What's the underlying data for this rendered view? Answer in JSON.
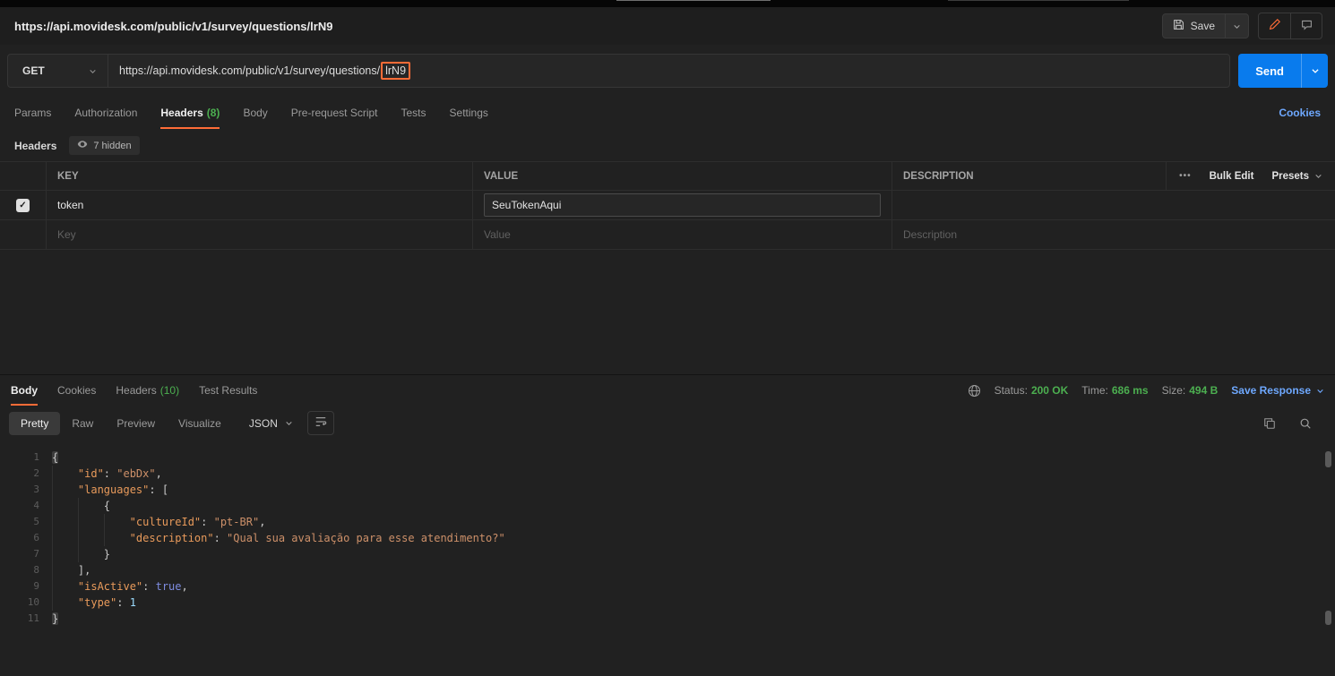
{
  "colors": {
    "accent": "#ff6c37",
    "green": "#4caf50",
    "link_blue": "#6ea8fe",
    "send_blue": "#097bed"
  },
  "titlebar": {
    "title": "https://api.movidesk.com/public/v1/survey/questions/lrN9",
    "save_label": "Save"
  },
  "request": {
    "method": "GET",
    "url_prefix": "https://api.movidesk.com/public/v1/survey/questions/",
    "url_highlight": "lrN9",
    "send_label": "Send"
  },
  "request_tabs": {
    "params": "Params",
    "authorization": "Authorization",
    "headers": "Headers",
    "headers_count": "(8)",
    "body": "Body",
    "prerequest": "Pre-request Script",
    "tests": "Tests",
    "settings": "Settings",
    "cookies_link": "Cookies"
  },
  "headers_section": {
    "title": "Headers",
    "hidden_badge": "7 hidden",
    "col_key": "KEY",
    "col_value": "VALUE",
    "col_description": "DESCRIPTION",
    "more_icon": "•••",
    "bulk_edit": "Bulk Edit",
    "presets": "Presets",
    "row": {
      "key": "token",
      "value": "SeuTokenAqui",
      "description": ""
    },
    "placeholder": {
      "key": "Key",
      "value": "Value",
      "description": "Description"
    },
    "checkbox_glyph": "✓"
  },
  "response": {
    "tab_body": "Body",
    "tab_cookies": "Cookies",
    "tab_headers": "Headers",
    "tab_headers_count": "(10)",
    "tab_test_results": "Test Results",
    "status_label": "Status:",
    "status_value": "200 OK",
    "time_label": "Time:",
    "time_value": "686 ms",
    "size_label": "Size:",
    "size_value": "494 B",
    "save_response": "Save Response",
    "view_pretty": "Pretty",
    "view_raw": "Raw",
    "view_preview": "Preview",
    "view_visualize": "Visualize",
    "format": "JSON"
  },
  "code": {
    "lines": [
      {
        "indent": 0,
        "tokens": [
          {
            "t": "{",
            "c": "p hl"
          }
        ]
      },
      {
        "indent": 1,
        "tokens": [
          {
            "t": "\"id\"",
            "c": "k"
          },
          {
            "t": ": ",
            "c": "p"
          },
          {
            "t": "\"ebDx\"",
            "c": "s"
          },
          {
            "t": ",",
            "c": "p"
          }
        ]
      },
      {
        "indent": 1,
        "tokens": [
          {
            "t": "\"languages\"",
            "c": "k"
          },
          {
            "t": ": ",
            "c": "p"
          },
          {
            "t": "[",
            "c": "p"
          }
        ]
      },
      {
        "indent": 2,
        "tokens": [
          {
            "t": "{",
            "c": "p"
          }
        ]
      },
      {
        "indent": 3,
        "tokens": [
          {
            "t": "\"cultureId\"",
            "c": "k"
          },
          {
            "t": ": ",
            "c": "p"
          },
          {
            "t": "\"pt-BR\"",
            "c": "s"
          },
          {
            "t": ",",
            "c": "p"
          }
        ]
      },
      {
        "indent": 3,
        "tokens": [
          {
            "t": "\"description\"",
            "c": "k"
          },
          {
            "t": ": ",
            "c": "p"
          },
          {
            "t": "\"Qual sua avaliação para esse atendimento?\"",
            "c": "s"
          }
        ]
      },
      {
        "indent": 2,
        "tokens": [
          {
            "t": "}",
            "c": "p"
          }
        ]
      },
      {
        "indent": 1,
        "tokens": [
          {
            "t": "],",
            "c": "p"
          }
        ]
      },
      {
        "indent": 1,
        "tokens": [
          {
            "t": "\"isActive\"",
            "c": "k"
          },
          {
            "t": ": ",
            "c": "p"
          },
          {
            "t": "true",
            "c": "b"
          },
          {
            "t": ",",
            "c": "p"
          }
        ]
      },
      {
        "indent": 1,
        "tokens": [
          {
            "t": "\"type\"",
            "c": "k"
          },
          {
            "t": ": ",
            "c": "p"
          },
          {
            "t": "1",
            "c": "n"
          }
        ]
      },
      {
        "indent": 0,
        "tokens": [
          {
            "t": "}",
            "c": "p hl"
          }
        ]
      }
    ]
  }
}
